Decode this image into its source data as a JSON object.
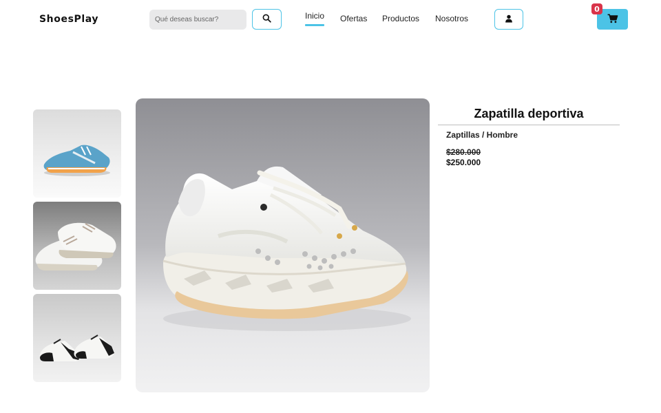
{
  "header": {
    "brand": "ShoesPlay",
    "search": {
      "placeholder": "Qué deseas buscar?",
      "value": ""
    },
    "nav": [
      {
        "label": "Inicio",
        "active": true
      },
      {
        "label": "Ofertas",
        "active": false
      },
      {
        "label": "Productos",
        "active": false
      },
      {
        "label": "Nosotros",
        "active": false
      }
    ],
    "cart_count": "0"
  },
  "gallery": {
    "thumbnails": [
      "blue-running-shoe",
      "white-casual-sneaker",
      "black-white-oxford"
    ],
    "main_image": "white-sport-sneaker"
  },
  "product": {
    "title": "Zapatilla deportiva",
    "category": "Zaptillas / Hombre",
    "old_price": "$280.000",
    "price": "$250.000"
  },
  "colors": {
    "accent": "#4cc3e6",
    "badge": "#d9344a",
    "search_bg": "#e9e9ea"
  },
  "icons": [
    "search-icon",
    "user-icon",
    "cart-icon"
  ]
}
